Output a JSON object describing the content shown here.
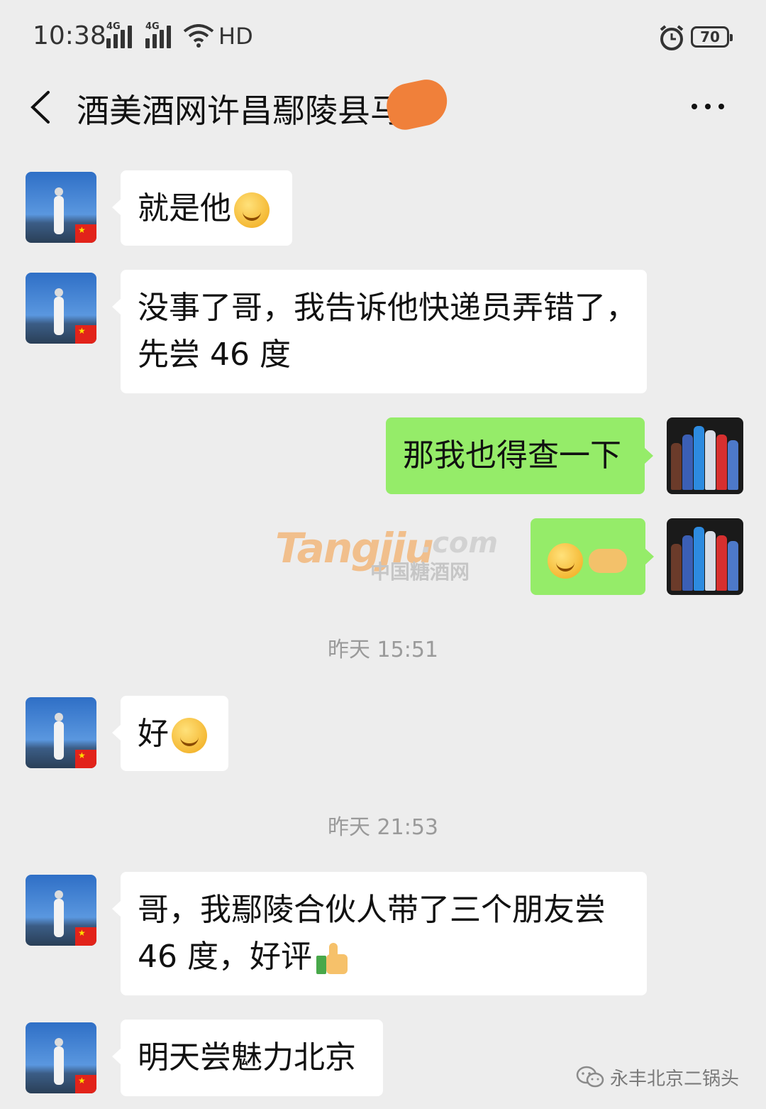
{
  "status_bar": {
    "time": "10:38",
    "network_1": "4G",
    "network_2": "4G",
    "hd": "HD",
    "battery": "70"
  },
  "header": {
    "title": "酒美酒网许昌鄢陵县马"
  },
  "messages": [
    {
      "side": "left",
      "text": "就是他",
      "emoji": "thinking-emoji"
    },
    {
      "side": "left",
      "line1": "没事了哥，我告诉他快递员弄错了，",
      "line2": "先尝 46 度"
    },
    {
      "side": "right",
      "text": "那我也得查一下"
    },
    {
      "side": "right",
      "emoji": [
        "smile-emoji",
        "handshake-emoji"
      ]
    },
    {
      "side": "left",
      "text": "好",
      "emoji": "thinking-emoji"
    },
    {
      "side": "left",
      "line1": "哥，我鄢陵合伙人带了三个朋友尝",
      "line2": "46 度，好评",
      "emoji": "thumbs-up-emoji"
    },
    {
      "side": "left",
      "text": "明天尝魅力北京"
    }
  ],
  "timestamps": [
    "昨天 15:51",
    "昨天 21:53"
  ],
  "watermark": {
    "main": "Tangjiu",
    "domain": ".com",
    "sub": "中国糖酒网"
  },
  "footer": {
    "brand": "永丰北京二锅头"
  },
  "colors": {
    "background": "#ededed",
    "bubble_left": "#ffffff",
    "bubble_right": "#95ec69"
  }
}
